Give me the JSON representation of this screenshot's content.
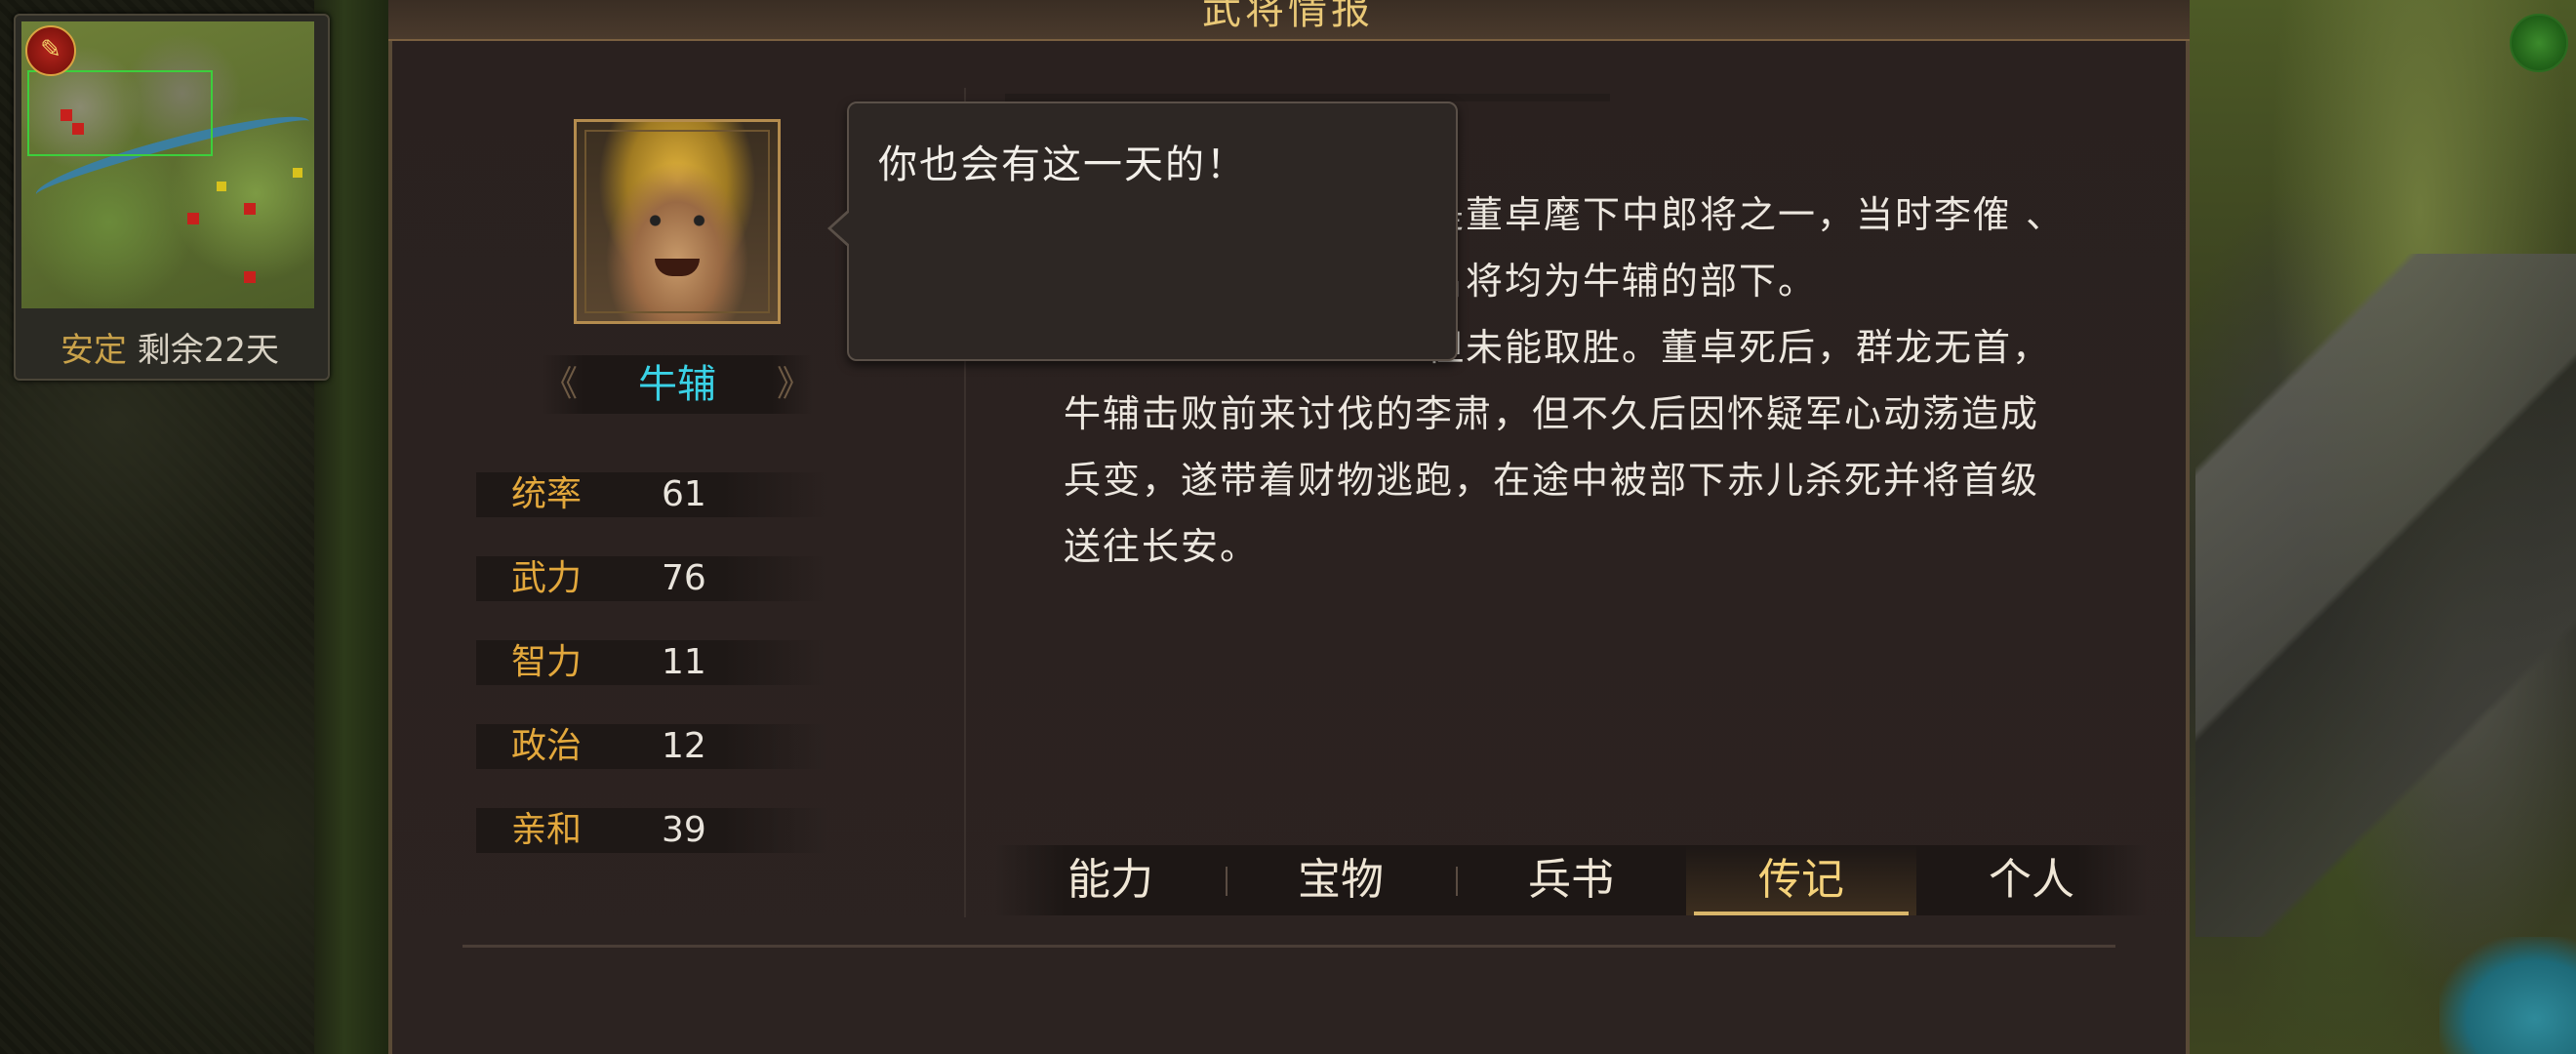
{
  "panel": {
    "title": "武将情报"
  },
  "minimap": {
    "status_label": "安定",
    "status_remaining": "剩余22天"
  },
  "general": {
    "name": "牛辅",
    "stats": [
      {
        "label": "统率",
        "value": "61"
      },
      {
        "label": "武力",
        "value": "76"
      },
      {
        "label": "智力",
        "value": "11"
      },
      {
        "label": "政治",
        "value": "12"
      },
      {
        "label": "亲和",
        "value": "39"
      }
    ]
  },
  "bubble": {
    "text": "你也会有这一天的！"
  },
  "biography": {
    "lines": [
      "是董卓麾下中郎将之一，当时李傕 、",
      "名将均为牛辅的部下。",
      "但未能取胜。董卓死后，群龙无首，",
      "牛辅击败前来讨伐的李肃，但不久后因怀疑军心动荡造成",
      "兵变，遂带着财物逃跑，在途中被部下赤儿杀死并将首级",
      "送往长安。"
    ]
  },
  "tabs": [
    {
      "label": "能力",
      "active": false
    },
    {
      "label": "宝物",
      "active": false
    },
    {
      "label": "兵书",
      "active": false
    },
    {
      "label": "传记",
      "active": true
    },
    {
      "label": "个人",
      "active": false
    }
  ]
}
